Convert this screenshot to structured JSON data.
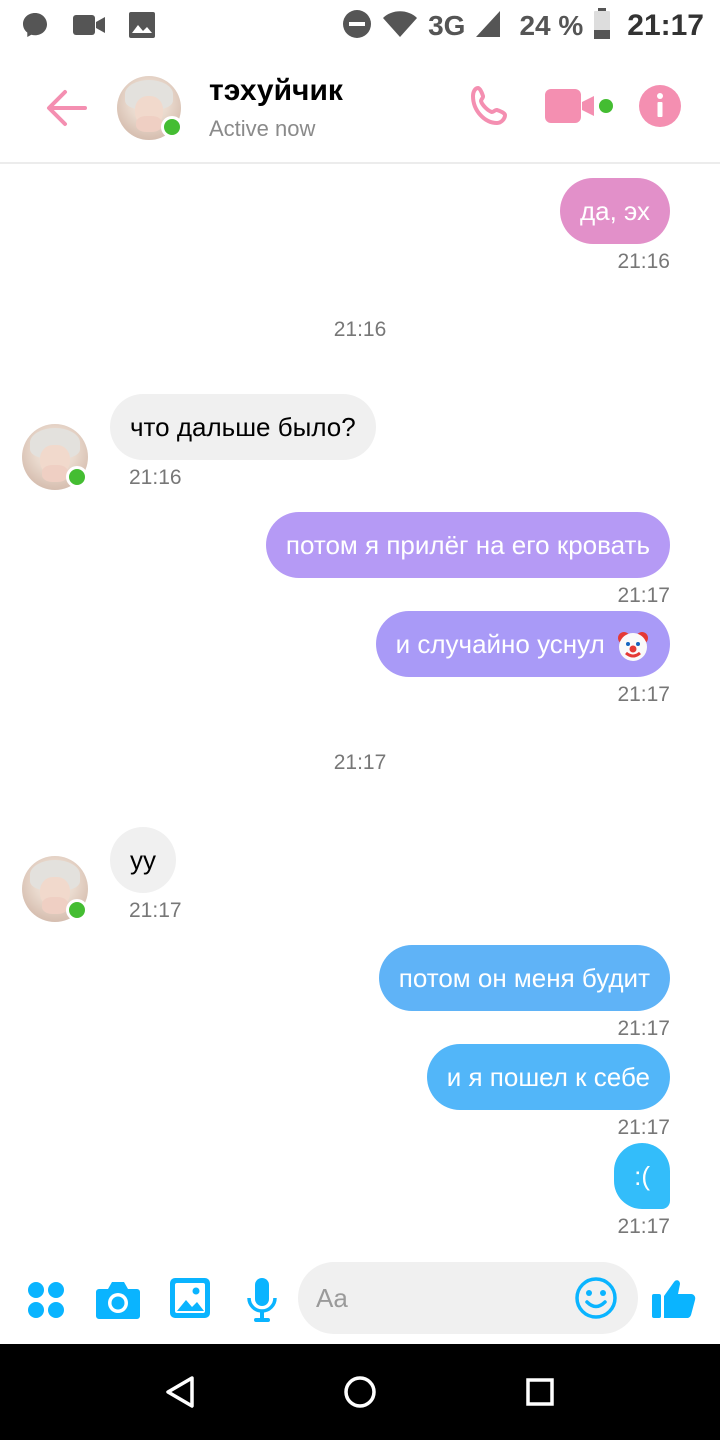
{
  "status_bar": {
    "network": "3G",
    "battery": "24 %",
    "time": "21:17",
    "icons": [
      "messenger-bubble-icon",
      "video-camera-icon",
      "image-icon",
      "do-not-disturb-icon",
      "wifi-icon",
      "signal-icon",
      "battery-icon"
    ]
  },
  "header": {
    "contact_name": "тэхуйчик",
    "status": "Active now",
    "accent_color": "#f48fb1"
  },
  "messages": [
    {
      "side": "out",
      "text": "да, эх",
      "time": "21:16",
      "color": "#e290c9"
    },
    {
      "divider": "21:16"
    },
    {
      "side": "in",
      "text": "что дальше было?",
      "time": "21:16"
    },
    {
      "side": "out",
      "text": "потом я прилёг на его кровать",
      "time": "21:17",
      "color": "#b59af5"
    },
    {
      "side": "out",
      "text": "и случайно уснул",
      "emoji": "clown-face-icon",
      "time": "21:17",
      "color": "#a99af7"
    },
    {
      "divider": "21:17"
    },
    {
      "side": "in",
      "text": "уу",
      "time": "21:17"
    },
    {
      "side": "out",
      "text": "потом он меня будит",
      "time": "21:17",
      "color": "#5fb3f7"
    },
    {
      "side": "out",
      "text": "и я пошел к себе",
      "time": "21:17",
      "color": "#52b6f9"
    },
    {
      "side": "out",
      "text": ":(",
      "time": "21:17",
      "color": "#33bdfa"
    }
  ],
  "composer": {
    "placeholder": "Aa",
    "accent_color": "#0ab4ff"
  },
  "nav": {
    "icons": [
      "back-triangle-icon",
      "home-circle-icon",
      "recents-square-icon"
    ]
  }
}
